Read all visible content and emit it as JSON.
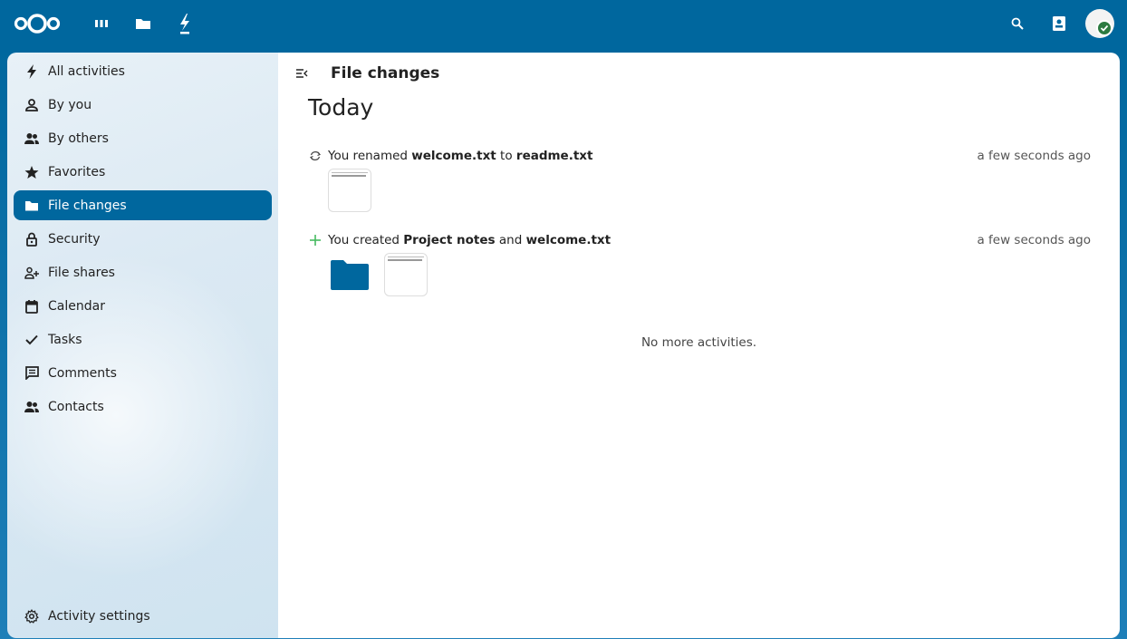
{
  "header": {
    "logo_icon": "nextcloud-logo",
    "apps": [
      {
        "name": "dashboard-icon"
      },
      {
        "name": "files-icon"
      },
      {
        "name": "activity-icon"
      }
    ],
    "right": [
      "search-icon",
      "contacts-icon",
      "avatar"
    ]
  },
  "sidebar": {
    "items": [
      {
        "label": "All activities",
        "icon": "bolt-icon",
        "active": false
      },
      {
        "label": "By you",
        "icon": "user-icon",
        "active": false
      },
      {
        "label": "By others",
        "icon": "users-icon",
        "active": false
      },
      {
        "label": "Favorites",
        "icon": "star-icon",
        "active": false
      },
      {
        "label": "File changes",
        "icon": "folder-icon",
        "active": true
      },
      {
        "label": "Security",
        "icon": "lock-icon",
        "active": false
      },
      {
        "label": "File shares",
        "icon": "share-user-icon",
        "active": false
      },
      {
        "label": "Calendar",
        "icon": "calendar-icon",
        "active": false
      },
      {
        "label": "Tasks",
        "icon": "check-icon",
        "active": false
      },
      {
        "label": "Comments",
        "icon": "comment-icon",
        "active": false
      },
      {
        "label": "Contacts",
        "icon": "contacts-group-icon",
        "active": false
      }
    ],
    "settings_label": "Activity settings"
  },
  "main": {
    "title": "File changes",
    "section": "Today",
    "activities": [
      {
        "icon": "rename-icon",
        "prefix": "You renamed ",
        "bold1": "welcome.txt",
        "mid": " to ",
        "bold2": "readme.txt",
        "time": "a few seconds ago"
      },
      {
        "icon": "plus-icon",
        "prefix": "You created ",
        "bold1": "Project notes",
        "mid": " and ",
        "bold2": "welcome.txt",
        "time": "a few seconds ago"
      }
    ],
    "no_more": "No more activities."
  },
  "colors": {
    "brand": "#00679e",
    "active_bg": "#00679e",
    "plus": "#46ba61",
    "status": "#2d7b41"
  }
}
